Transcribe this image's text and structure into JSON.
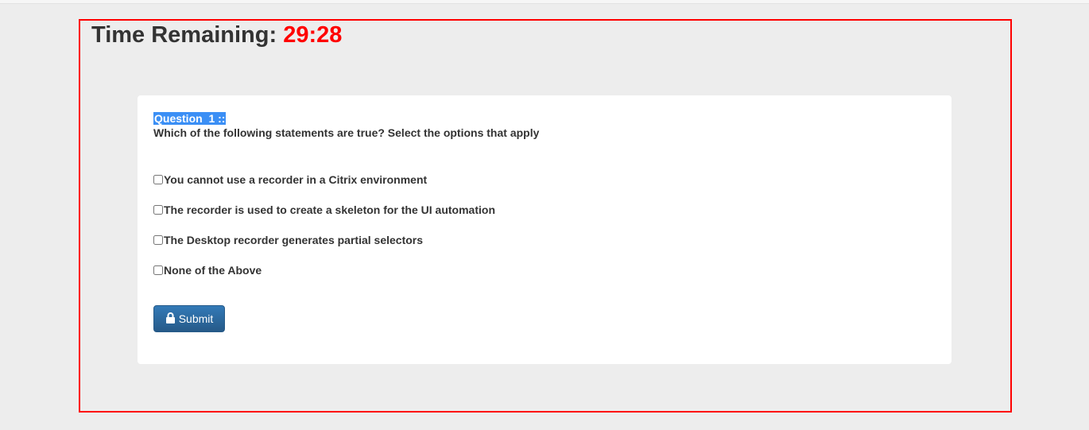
{
  "timer": {
    "label": "Time Remaining:",
    "value": "29:28"
  },
  "question": {
    "label": "Question  1 ::",
    "text": "Which of the following statements are true? Select the options that apply",
    "options": [
      {
        "label": "You cannot use a recorder in a Citrix environment",
        "checked": false
      },
      {
        "label": "The recorder is used to create a skeleton for the UI automation",
        "checked": false
      },
      {
        "label": "The Desktop recorder generates partial selectors",
        "checked": false
      },
      {
        "label": "None of the Above",
        "checked": false
      }
    ]
  },
  "submit": {
    "label": "Submit",
    "icon": "lock-icon"
  },
  "colors": {
    "timer_value": "#ff0000",
    "frame_border": "#ff0000",
    "button": "#337ab7",
    "highlight": "#3b8ff5"
  }
}
